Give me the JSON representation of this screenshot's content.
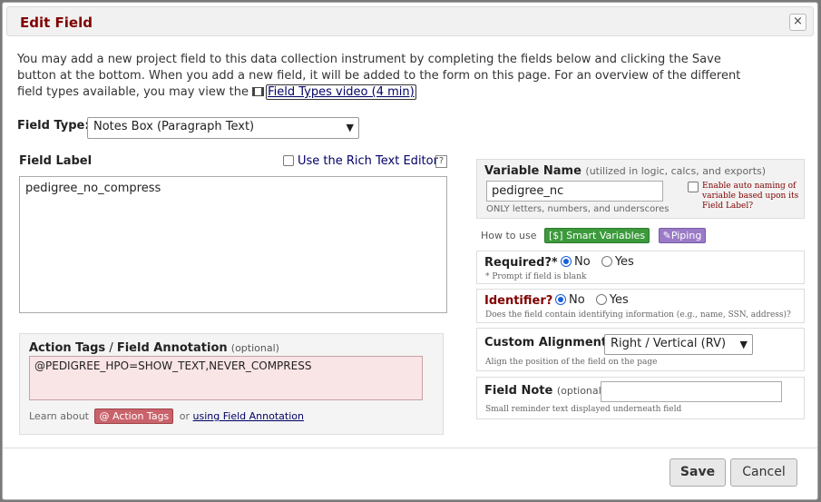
{
  "dialog": {
    "title": "Edit Field",
    "close_icon": "×"
  },
  "intro": {
    "text": "You may add a new project field to this data collection instrument by completing the fields below and clicking the Save button at the bottom. When you add a new field, it will be added to the form on this page. For an overview of the different field types available, you may view the",
    "video_link": "Field Types video (4 min)",
    "video_icon": "film-icon"
  },
  "field_type": {
    "label": "Field Type:",
    "selected": "Notes Box (Paragraph Text)"
  },
  "field_label": {
    "label": "Field Label",
    "value": "pedigree_no_compress",
    "rich_text_label": "Use the Rich Text Editor",
    "help": "?"
  },
  "action_tags": {
    "title": "Action Tags",
    "separator": "/",
    "title2": "Field Annotation",
    "optional": "(optional)",
    "value": "@PEDIGREE_HPO=SHOW_TEXT,NEVER_COMPRESS",
    "learn_prefix": "Learn about",
    "badge": "@ Action Tags",
    "or": "or",
    "link": "using Field Annotation"
  },
  "variable_name": {
    "label": "Variable Name",
    "hint": "(utilized in logic, calcs, and exports)",
    "value": "pedigree_nc",
    "note": "ONLY letters, numbers, and underscores",
    "auto_label": "Enable auto naming of variable based upon its Field Label?"
  },
  "howto": {
    "prefix": "How to use",
    "smart": "[$] Smart Variables",
    "piping": "Piping"
  },
  "required": {
    "label": "Required?*",
    "no": "No",
    "yes": "Yes",
    "selected": "No",
    "note": "* Prompt if field is blank"
  },
  "identifier": {
    "label": "Identifier?",
    "no": "No",
    "yes": "Yes",
    "selected": "No",
    "note": "Does the field contain identifying information (e.g., name, SSN, address)?"
  },
  "alignment": {
    "label": "Custom Alignment",
    "selected": "Right / Vertical (RV)",
    "note": "Align the position of the field on the page"
  },
  "field_note": {
    "label": "Field Note",
    "optional": "(optional)",
    "value": "",
    "note": "Small reminder text displayed underneath field"
  },
  "footer": {
    "save": "Save",
    "cancel": "Cancel"
  },
  "colors": {
    "title": "#800000",
    "action_box_bg": "#f9e4e6",
    "badge_red": "#c9636b",
    "badge_green": "#3c9a3c",
    "badge_purple": "#9b7bc7"
  }
}
